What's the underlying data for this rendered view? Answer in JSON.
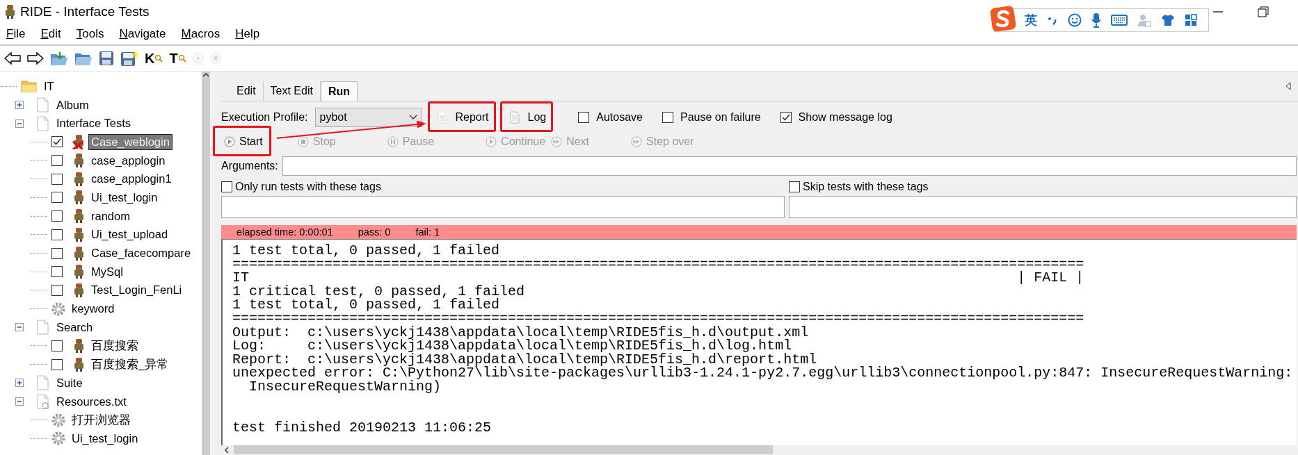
{
  "window": {
    "title": "RIDE - Interface Tests"
  },
  "ime_bar": {
    "mode": "英"
  },
  "menu": [
    "File",
    "Edit",
    "Tools",
    "Navigate",
    "Macros",
    "Help"
  ],
  "toolbar": [
    {
      "kind": "back",
      "disabled": false
    },
    {
      "kind": "forward",
      "disabled": false
    },
    {
      "kind": "open-suite",
      "disabled": false
    },
    {
      "kind": "open-directory",
      "disabled": false
    },
    {
      "kind": "save",
      "disabled": false
    },
    {
      "kind": "save-all",
      "disabled": false
    },
    {
      "kind": "search-keywords",
      "glyph": "K",
      "disabled": false
    },
    {
      "kind": "search-tests",
      "glyph": "T",
      "disabled": false
    },
    {
      "kind": "run",
      "disabled": true
    },
    {
      "kind": "stop",
      "disabled": true
    }
  ],
  "tree": [
    {
      "kind": "project",
      "label": "IT",
      "selected": false,
      "children": [
        {
          "kind": "suite",
          "label": "Album",
          "expanded": false,
          "selected": false
        },
        {
          "kind": "suite",
          "label": "Interface Tests",
          "expanded": true,
          "selected": false,
          "children": [
            {
              "kind": "test",
              "label": "Case_weblogin",
              "checked": true,
              "failed": true,
              "selected": true
            },
            {
              "kind": "test",
              "label": "case_applogin",
              "checked": false,
              "failed": false,
              "selected": false
            },
            {
              "kind": "test",
              "label": "case_applogin1",
              "checked": false,
              "failed": false,
              "selected": false
            },
            {
              "kind": "test",
              "label": "Ui_test_login",
              "checked": false,
              "failed": false,
              "selected": false
            },
            {
              "kind": "test",
              "label": "random",
              "checked": false,
              "failed": false,
              "selected": false
            },
            {
              "kind": "test",
              "label": "Ui_test_upload",
              "checked": false,
              "failed": false,
              "selected": false
            },
            {
              "kind": "test",
              "label": "Case_facecompare",
              "checked": false,
              "failed": false,
              "selected": false
            },
            {
              "kind": "test",
              "label": "MySql",
              "checked": false,
              "failed": false,
              "selected": false
            },
            {
              "kind": "test",
              "label": "Test_Login_FenLi",
              "checked": false,
              "failed": false,
              "selected": false
            },
            {
              "kind": "keyword",
              "label": "keyword",
              "selected": false
            }
          ]
        },
        {
          "kind": "suite",
          "label": "Search",
          "expanded": true,
          "selected": false,
          "children": [
            {
              "kind": "test",
              "label": "百度搜索",
              "checked": false,
              "failed": false,
              "selected": false
            },
            {
              "kind": "test",
              "label": "百度搜索_异常",
              "checked": false,
              "failed": false,
              "selected": false
            }
          ]
        },
        {
          "kind": "suite",
          "label": "Suite",
          "expanded": false,
          "selected": false
        },
        {
          "kind": "resource",
          "label": "Resources.txt",
          "expanded": true,
          "selected": false,
          "children": [
            {
              "kind": "keyword",
              "label": "打开浏览器",
              "selected": false
            },
            {
              "kind": "keyword",
              "label": "Ui_test_login",
              "selected": false
            }
          ]
        }
      ]
    }
  ],
  "editor": {
    "tabs": [
      {
        "label": "Edit",
        "selected": false
      },
      {
        "label": "Text Edit",
        "selected": false
      },
      {
        "label": "Run",
        "selected": true
      }
    ],
    "run": {
      "profile_label": "Execution Profile:",
      "profile": "pybot",
      "report_buttons": [
        {
          "kind": "report",
          "label": "Report",
          "highlighted": true
        },
        {
          "kind": "log",
          "label": "Log",
          "highlighted": true
        }
      ],
      "options": [
        {
          "label": "Autosave",
          "checked": false
        },
        {
          "label": "Pause on failure",
          "checked": false
        },
        {
          "label": "Show message log",
          "checked": true
        }
      ],
      "controls": [
        {
          "kind": "start",
          "label": "Start",
          "disabled": false,
          "highlighted": true
        },
        {
          "kind": "stop",
          "label": "Stop",
          "disabled": true,
          "highlighted": false
        },
        {
          "kind": "pause",
          "label": "Pause",
          "disabled": true,
          "highlighted": false
        },
        {
          "kind": "continue",
          "label": "Continue",
          "disabled": true,
          "highlighted": false
        },
        {
          "kind": "next",
          "label": "Next",
          "disabled": true,
          "highlighted": false
        },
        {
          "kind": "step-over",
          "label": "Step over",
          "disabled": true,
          "highlighted": false
        }
      ],
      "annotation_arrow": true,
      "arguments_label": "Arguments:",
      "tag_filters": [
        {
          "label": "Only run tests with these tags",
          "checked": false
        },
        {
          "label": "Skip tests with these tags",
          "checked": false
        }
      ],
      "status": {
        "failed": true,
        "elapsed": "elapsed time: 0:00:01",
        "pass": "pass: 0",
        "fail": "fail: 1"
      },
      "output": [
        {
          "kind": "text",
          "text": "1 test total, 0 passed, 1 failed"
        },
        {
          "kind": "rule",
          "text": "======================================================================================================"
        },
        {
          "kind": "result",
          "text": "IT",
          "verdict": "| FAIL |"
        },
        {
          "kind": "text",
          "text": "1 critical test, 0 passed, 1 failed"
        },
        {
          "kind": "text",
          "text": "1 test total, 0 passed, 1 failed"
        },
        {
          "kind": "rule",
          "text": "======================================================================================================"
        },
        {
          "kind": "text",
          "text": "Output:  c:\\users\\yckj1438\\appdata\\local\\temp\\RIDE5fis_h.d\\output.xml"
        },
        {
          "kind": "text",
          "text": "Log:     c:\\users\\yckj1438\\appdata\\local\\temp\\RIDE5fis_h.d\\log.html"
        },
        {
          "kind": "text",
          "text": "Report:  c:\\users\\yckj1438\\appdata\\local\\temp\\RIDE5fis_h.d\\report.html"
        },
        {
          "kind": "text",
          "text": "unexpected error: C:\\Python27\\lib\\site-packages\\urllib3-1.24.1-py2.7.egg\\urllib3\\connectionpool.py:847: InsecureRequestWarning:"
        },
        {
          "kind": "text",
          "text": "  InsecureRequestWarning)"
        },
        {
          "kind": "footer",
          "text": "test finished 20190213 11:06:25"
        }
      ]
    }
  }
}
